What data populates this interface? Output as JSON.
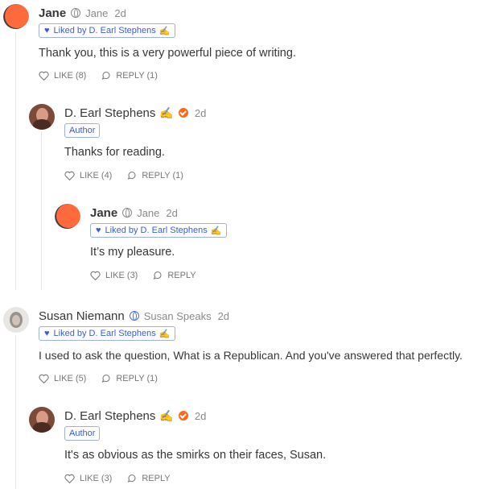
{
  "comments": [
    {
      "name": "Jane",
      "handle": "Jane",
      "date": "2d",
      "liked_by": "Liked by D. Earl Stephens",
      "liked_emoji": "✍",
      "text": "Thank you, this is a very powerful piece of writing.",
      "like": "LIKE (8)",
      "reply": "REPLY (1)"
    },
    {
      "name": "D. Earl Stephens",
      "emoji": "✍",
      "date": "2d",
      "badge": "Author",
      "text": "Thanks for reading.",
      "like": "LIKE (4)",
      "reply": "REPLY (1)"
    },
    {
      "name": "Jane",
      "handle": "Jane",
      "date": "2d",
      "liked_by": "Liked by D. Earl Stephens",
      "liked_emoji": "✍",
      "text": "It’s my pleasure.",
      "like": "LIKE (3)",
      "reply": "REPLY"
    },
    {
      "name": "Susan Niemann",
      "handle": "Susan Speaks",
      "date": "2d",
      "liked_by": "Liked by D. Earl Stephens",
      "liked_emoji": "✍",
      "text": "I used to ask the question, What is a Republican. And you've answered that perfectly.",
      "like": "LIKE (5)",
      "reply": "REPLY (1)"
    },
    {
      "name": "D. Earl Stephens",
      "emoji": "✍",
      "date": "2d",
      "badge": "Author",
      "text": "It's as obvious as the smirks on their faces, Susan.",
      "like": "LIKE (3)",
      "reply": "REPLY"
    }
  ],
  "colors": {
    "accent": "#ff6719",
    "link_blue": "#3b5bdb",
    "muted": "#8a8a8a"
  }
}
